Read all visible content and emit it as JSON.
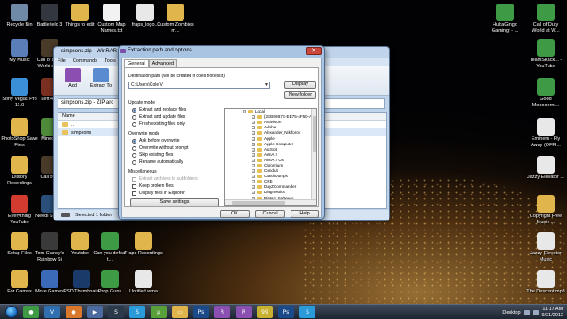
{
  "desktop": {
    "left_icons": [
      {
        "label": "Recycle Bin",
        "icon": "recycle-bin-icon",
        "color": "#6f8aa6"
      },
      {
        "label": "My Music",
        "icon": "music-icon",
        "color": "#5a7fb8"
      },
      {
        "label": "Sony Vegas Pro 11.0",
        "icon": "vegas-icon",
        "color": "#3b8fd6"
      },
      {
        "label": "PhotoShop Save Files",
        "icon": "folder-icon",
        "color": "#e0b54c"
      },
      {
        "label": "Distory Recordings",
        "icon": "folder-icon",
        "color": "#e0b54c"
      },
      {
        "label": "Everything YouTube",
        "icon": "youtube-icon",
        "color": "#d23b2f"
      },
      {
        "label": "Setup Files",
        "icon": "folder-icon",
        "color": "#e0b54c"
      },
      {
        "label": "For Games",
        "icon": "folder-icon",
        "color": "#e0b54c"
      }
    ],
    "col2_icons": [
      {
        "label": "Battlefield 3",
        "icon": "battlefield-icon",
        "color": "#333840"
      },
      {
        "label": "Call of Duty World at W",
        "icon": "cod-icon",
        "color": "#4a3a28"
      },
      {
        "label": "Left 4 D",
        "icon": "l4d-icon",
        "color": "#7a3020"
      },
      {
        "label": "Minecra",
        "icon": "minecraft-icon",
        "color": "#4f8a3a"
      },
      {
        "label": "Call of D",
        "icon": "cod-icon",
        "color": "#4a3a28"
      },
      {
        "label": "Needl Speed",
        "icon": "nfs-icon",
        "color": "#2a4f7a"
      },
      {
        "label": "Tom Clancy's Rainbow Si",
        "icon": "rainbow-icon",
        "color": "#3a3a3a"
      },
      {
        "label": "More Games",
        "icon": "games-icon",
        "color": "#3a6ab8"
      }
    ],
    "top_icons": [
      {
        "label": "Things to edit",
        "icon": "folder-icon",
        "color": "#e0b54c"
      },
      {
        "label": "Custom Map Names.txt",
        "icon": "text-file-icon",
        "color": "#f2f2f2"
      },
      {
        "label": "fraps_logo...",
        "icon": "fraps-icon",
        "color": "#e8e8e8"
      },
      {
        "label": "Custom Zombies m...",
        "icon": "folder-icon",
        "color": "#e0b54c"
      }
    ],
    "bottom_icons": [
      {
        "label": "Youtube",
        "icon": "folder-icon",
        "color": "#e0b54c"
      },
      {
        "label": "Can you defeat t...",
        "icon": "chrome-icon",
        "color": "#3e9a45"
      },
      {
        "label": "Fraps Recordings",
        "icon": "folder-icon",
        "color": "#e0b54c"
      },
      {
        "label": "PSD Thumbnails",
        "icon": "psd-icon",
        "color": "#1a3a6a"
      },
      {
        "label": "Prop Guns",
        "icon": "chrome-icon",
        "color": "#3e9a45"
      },
      {
        "label": "Untitled.wma",
        "icon": "media-icon",
        "color": "#e8e8e8"
      }
    ],
    "right_icons": [
      {
        "label": "HubaGingo Gaming! - ...",
        "icon": "chrome-icon",
        "color": "#3e9a45"
      },
      {
        "label": "Call of Duty World at W...",
        "icon": "chrome-icon",
        "color": "#3e9a45"
      },
      {
        "label": "TeamSkack... - YouTube",
        "icon": "chrome-icon",
        "color": "#3e9a45"
      },
      {
        "label": "Good Mooooorni...",
        "icon": "chrome-icon",
        "color": "#3e9a45"
      },
      {
        "label": "Eminem - Fly Away (OFFI...",
        "icon": "media-icon",
        "color": "#e8e8e8"
      },
      {
        "label": "Jazzy Elevator ...",
        "icon": "media-icon",
        "color": "#e8e8e8"
      },
      {
        "label": "Copyright Free Music ...",
        "icon": "folder-icon",
        "color": "#e0b54c"
      },
      {
        "label": "Jazzy Elevator Music",
        "icon": "media-icon",
        "color": "#e8e8e8"
      },
      {
        "label": "The Descent.mp3",
        "icon": "media-icon",
        "color": "#e8e8e8"
      }
    ]
  },
  "winrar": {
    "title": "simpsons.zip - WinRAR",
    "menu": [
      "File",
      "Commands",
      "Tools"
    ],
    "toolbar": [
      {
        "label": "Add",
        "icon": "add-icon",
        "color": "#8a4fb0"
      },
      {
        "label": "Extract To",
        "icon": "extract-icon",
        "color": "#5a8ad0"
      }
    ],
    "path": "simpsons.zip - ZIP arc",
    "column_header": "Name",
    "rows": [
      "..",
      "simpsons"
    ],
    "status": "Selected 1 folder"
  },
  "dialog": {
    "title": "Extraction path and options",
    "close_glyph": "✕",
    "tabs": [
      "General",
      "Advanced"
    ],
    "dest_label": "Destination path (will be created if does not exist)",
    "dest_value": "C:\\Users\\Cole V",
    "display_btn": "Display",
    "new_folder_btn": "New folder",
    "update_mode": {
      "title": "Update mode",
      "options": [
        {
          "label": "Extract and replace files",
          "selected": true
        },
        {
          "label": "Extract and update files",
          "selected": false
        },
        {
          "label": "Fresh existing files only",
          "selected": false
        }
      ]
    },
    "overwrite_mode": {
      "title": "Overwrite mode",
      "options": [
        {
          "label": "Ask before overwrite",
          "selected": true
        },
        {
          "label": "Overwrite without prompt",
          "selected": false
        },
        {
          "label": "Skip existing files",
          "selected": false
        },
        {
          "label": "Rename automatically",
          "selected": false
        }
      ]
    },
    "misc": {
      "title": "Miscellaneous",
      "options": [
        {
          "label": "Extract archives to subfolders",
          "disabled": true
        },
        {
          "label": "Keep broken files",
          "disabled": false
        },
        {
          "label": "Display files in Explorer",
          "disabled": false
        }
      ]
    },
    "save_settings_btn": "Save settings",
    "tree": {
      "root": "Local",
      "items": [
        "{2EB92B7E-EE75-4F5D-A",
        "Activision",
        "Adobe",
        "Alexander_Nikiforov",
        "Apple",
        "Apple Computer",
        "ArcSoft",
        "ArmA 2",
        "ArmA 2 OA",
        "Chromium",
        "Conduit",
        "CrashDumps",
        "CRE",
        "DayZCommander",
        "Diagnostics",
        "Distory Software"
      ]
    },
    "ok_btn": "OK",
    "cancel_btn": "Cancel",
    "help_btn": "Help"
  },
  "taskbar": {
    "apps": [
      {
        "name": "chrome-taskbar-icon",
        "color": "#3e9a45",
        "glyph": "●"
      },
      {
        "name": "vegas-taskbar-icon",
        "color": "#2f6fb0",
        "glyph": "V"
      },
      {
        "name": "firefox-taskbar-icon",
        "color": "#d9782a",
        "glyph": "●"
      },
      {
        "name": "media-taskbar-icon",
        "color": "#4a6aa0",
        "glyph": "▶"
      },
      {
        "name": "steam-taskbar-icon",
        "color": "#2a3a4a",
        "glyph": "S"
      },
      {
        "name": "skype-taskbar-icon",
        "color": "#2a9ad8",
        "glyph": "S"
      },
      {
        "name": "utorrent-taskbar-icon",
        "color": "#5aa03a",
        "glyph": "µ"
      },
      {
        "name": "explorer-taskbar-icon",
        "color": "#e0b54c",
        "glyph": "▭"
      },
      {
        "name": "photoshop-taskbar-icon",
        "color": "#1a4a8a",
        "glyph": "Ps"
      },
      {
        "name": "winrar-taskbar-icon",
        "color": "#8a4fb0",
        "glyph": "R"
      },
      {
        "name": "winrar2-taskbar-icon",
        "color": "#8a4fb0",
        "glyph": "R"
      },
      {
        "name": "fraps-taskbar-icon",
        "color": "#c8b030",
        "glyph": "99"
      },
      {
        "name": "photoshop2-taskbar-icon",
        "color": "#1a4a8a",
        "glyph": "Ps"
      },
      {
        "name": "skype2-taskbar-icon",
        "color": "#2a9ad8",
        "glyph": "S"
      }
    ],
    "desktop_label": "Desktop",
    "time": "11:17 AM",
    "date": "9/21/2012"
  }
}
